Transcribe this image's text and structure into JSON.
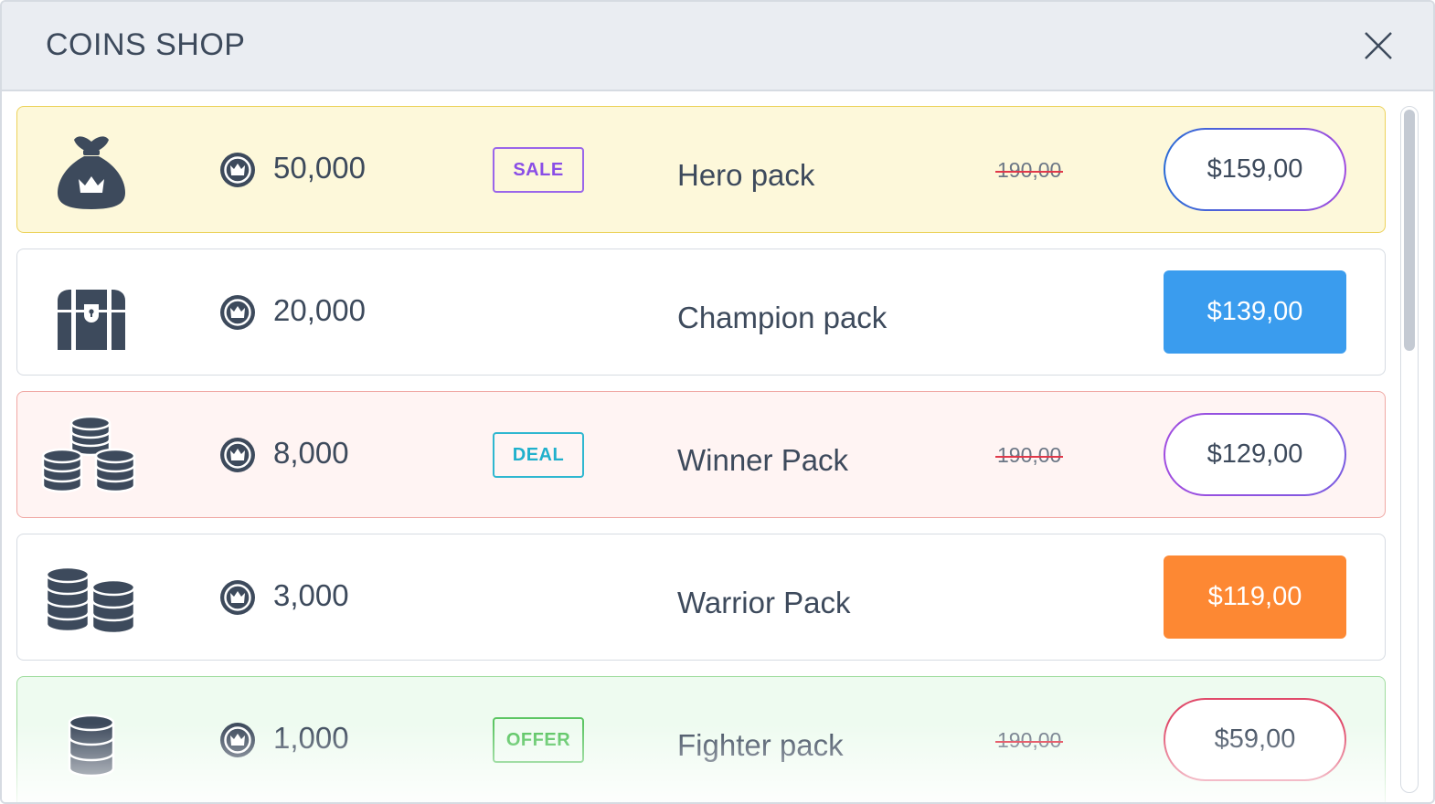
{
  "window": {
    "title": "COINS SHOP"
  },
  "colors": {
    "icon": "#3d4a5c",
    "yellow_row": "#fdf8da",
    "red_row": "#fff4f3",
    "green_row": "#eefbf0",
    "blue_button": "#3a9cee",
    "orange_button": "#fd8833",
    "strike": "#e0394a"
  },
  "packs": [
    {
      "icon": "money-bag-icon",
      "coins": "50,000",
      "badge": "SALE",
      "name": "Hero pack",
      "old_price": "190,00",
      "price": "$159,00"
    },
    {
      "icon": "treasure-chest-icon",
      "coins": "20,000",
      "badge": "",
      "name": "Champion pack",
      "old_price": "",
      "price": "$139,00"
    },
    {
      "icon": "coin-pile-icon",
      "coins": "8,000",
      "badge": "DEAL",
      "name": "Winner Pack",
      "old_price": "190,00",
      "price": "$129,00"
    },
    {
      "icon": "coin-stacks-icon",
      "coins": "3,000",
      "badge": "",
      "name": "Warrior Pack",
      "old_price": "",
      "price": "$119,00"
    },
    {
      "icon": "coin-stack-icon",
      "coins": "1,000",
      "badge": "OFFER",
      "name": "Fighter pack",
      "old_price": "190,00",
      "price": "$59,00"
    }
  ]
}
